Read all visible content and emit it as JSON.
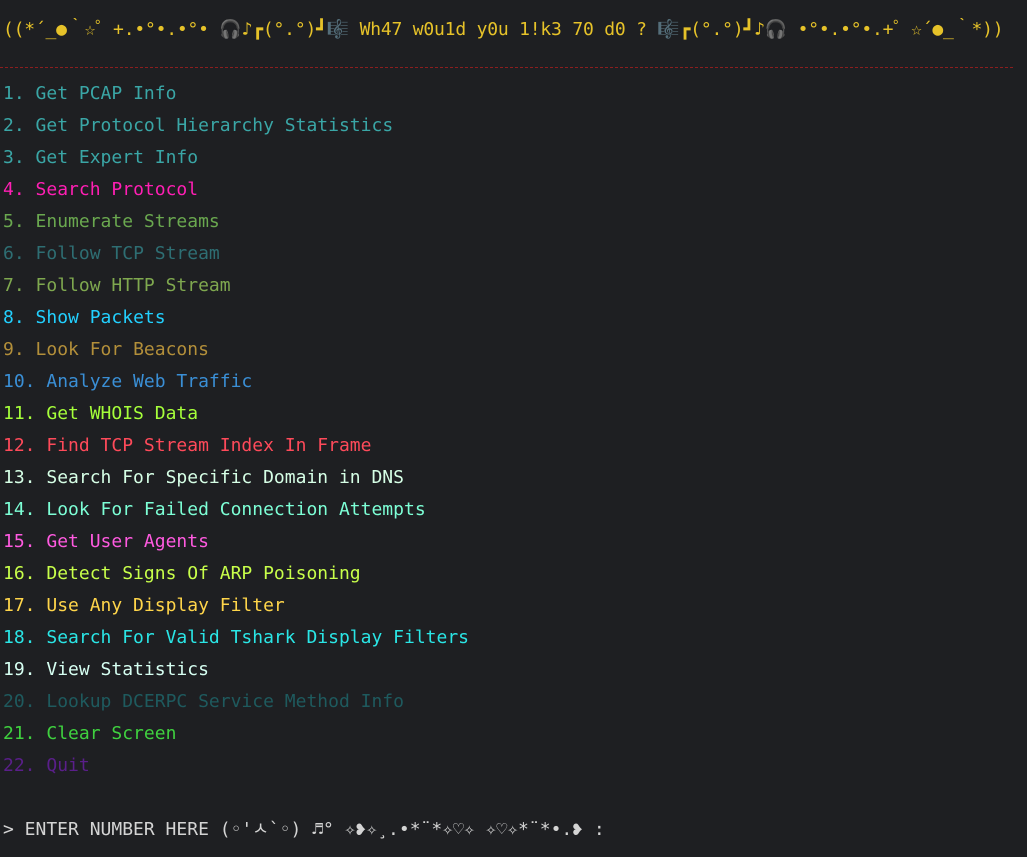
{
  "banner": "((*´_●｀☆゜+.•°•.•°• 🎧♪┏(°.°)┛🎼 Wh47 w0u1d y0u 1!k3 70 d0 ? 🎼┏(°.°)┛♪🎧 •°•.•°•.+゜☆´●_｀*))",
  "menu": [
    {
      "num": "1.",
      "label": "Get PCAP Info",
      "color": "#3aa6a6"
    },
    {
      "num": "2.",
      "label": "Get Protocol Hierarchy Statistics",
      "color": "#3aa6a6"
    },
    {
      "num": "3.",
      "label": "Get Expert Info",
      "color": "#3aa6a6"
    },
    {
      "num": "4.",
      "label": "Search Protocol",
      "color": "#ff1fb4"
    },
    {
      "num": "5.",
      "label": "Enumerate Streams",
      "color": "#6aa84f"
    },
    {
      "num": "6.",
      "label": "Follow TCP Stream",
      "color": "#2e6e73"
    },
    {
      "num": "7.",
      "label": "Follow HTTP Stream",
      "color": "#7fa84f"
    },
    {
      "num": "8.",
      "label": "Show Packets",
      "color": "#22d0ff"
    },
    {
      "num": "9.",
      "label": "Look For Beacons",
      "color": "#b38f3a"
    },
    {
      "num": "10.",
      "label": "Analyze Web Traffic",
      "color": "#3a8fd6"
    },
    {
      "num": "11.",
      "label": "Get WHOIS Data",
      "color": "#a6ff3a"
    },
    {
      "num": "12.",
      "label": "Find TCP Stream Index In Frame",
      "color": "#ff4a5a"
    },
    {
      "num": "13.",
      "label": "Search For Specific Domain in DNS",
      "color": "#d6ffe6"
    },
    {
      "num": "14.",
      "label": "Look For Failed Connection Attempts",
      "color": "#7dffd6"
    },
    {
      "num": "15.",
      "label": "Get User Agents",
      "color": "#ff5ae0"
    },
    {
      "num": "16.",
      "label": "Detect Signs Of ARP Poisoning",
      "color": "#c8ff4a"
    },
    {
      "num": "17.",
      "label": "Use Any Display Filter",
      "color": "#ffd54a"
    },
    {
      "num": "18.",
      "label": "Search For Valid Tshark Display Filters",
      "color": "#2ae6e6"
    },
    {
      "num": "19.",
      "label": "View Statistics",
      "color": "#d6fff2"
    },
    {
      "num": "20.",
      "label": "Lookup DCERPC Service Method Info",
      "color": "#1e5a5e"
    },
    {
      "num": "21.",
      "label": "Clear Screen",
      "color": "#3fd13f"
    },
    {
      "num": "22.",
      "label": "Quit",
      "color": "#5a1f8a"
    }
  ],
  "prompt": "> ENTER NUMBER HERE (◦'ㅅ`◦) ♬° ✧❥✧¸.•*¨*✧♡✧ ✧♡✧*¨*•.❥ :",
  "colors": {
    "background": "#1e1f22",
    "banner": "#e6c229",
    "divider": "#8b1e1e",
    "prompt": "#d4d4d4"
  }
}
